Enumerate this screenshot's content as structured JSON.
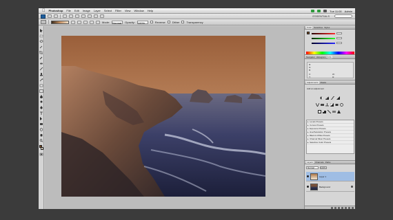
{
  "menubar": {
    "app_name": "Photoshop",
    "items": [
      "File",
      "Edit",
      "Image",
      "Layer",
      "Select",
      "Filter",
      "View",
      "Window",
      "Help"
    ],
    "clock": "Tue 11:00",
    "user": "Admin"
  },
  "appbar": {
    "workspace": "ESSENTIALS"
  },
  "options": {
    "mode_label": "Mode:",
    "mode_value": "Normal",
    "opacity_label": "Opacity:",
    "opacity_value": "100%",
    "reverse_label": "Reverse",
    "dither_label": "Dither",
    "transparency_label": "Transparency"
  },
  "panels": {
    "color_tabs": [
      "Color",
      "Swatches",
      "Styles"
    ],
    "info_tabs": [
      "Navigator",
      "Histogram",
      "Info"
    ],
    "info_values": [
      "R:",
      "G:",
      "B:",
      "X:",
      "Y:",
      "W:",
      "H:"
    ],
    "adjustments_tabs": [
      "Adjustments",
      "Masks"
    ],
    "adjustments_title": "Add an adjustment",
    "presets": [
      "Levels Presets",
      "Curves Presets",
      "Exposure Presets",
      "Hue/Saturation Presets",
      "Black & White Presets",
      "Channel Mixer Presets",
      "Selective Color Presets"
    ],
    "layers_tabs": [
      "Layers",
      "Channels",
      "Paths"
    ],
    "blend_mode": "Normal",
    "opacity": "100%",
    "layers": [
      {
        "name": "Layer 1",
        "selected": true
      },
      {
        "name": "Background",
        "selected": false
      }
    ]
  },
  "colors": {
    "selection": "#9fbde4",
    "foreground": "#7a4a22",
    "background": "#f2e4cf"
  }
}
